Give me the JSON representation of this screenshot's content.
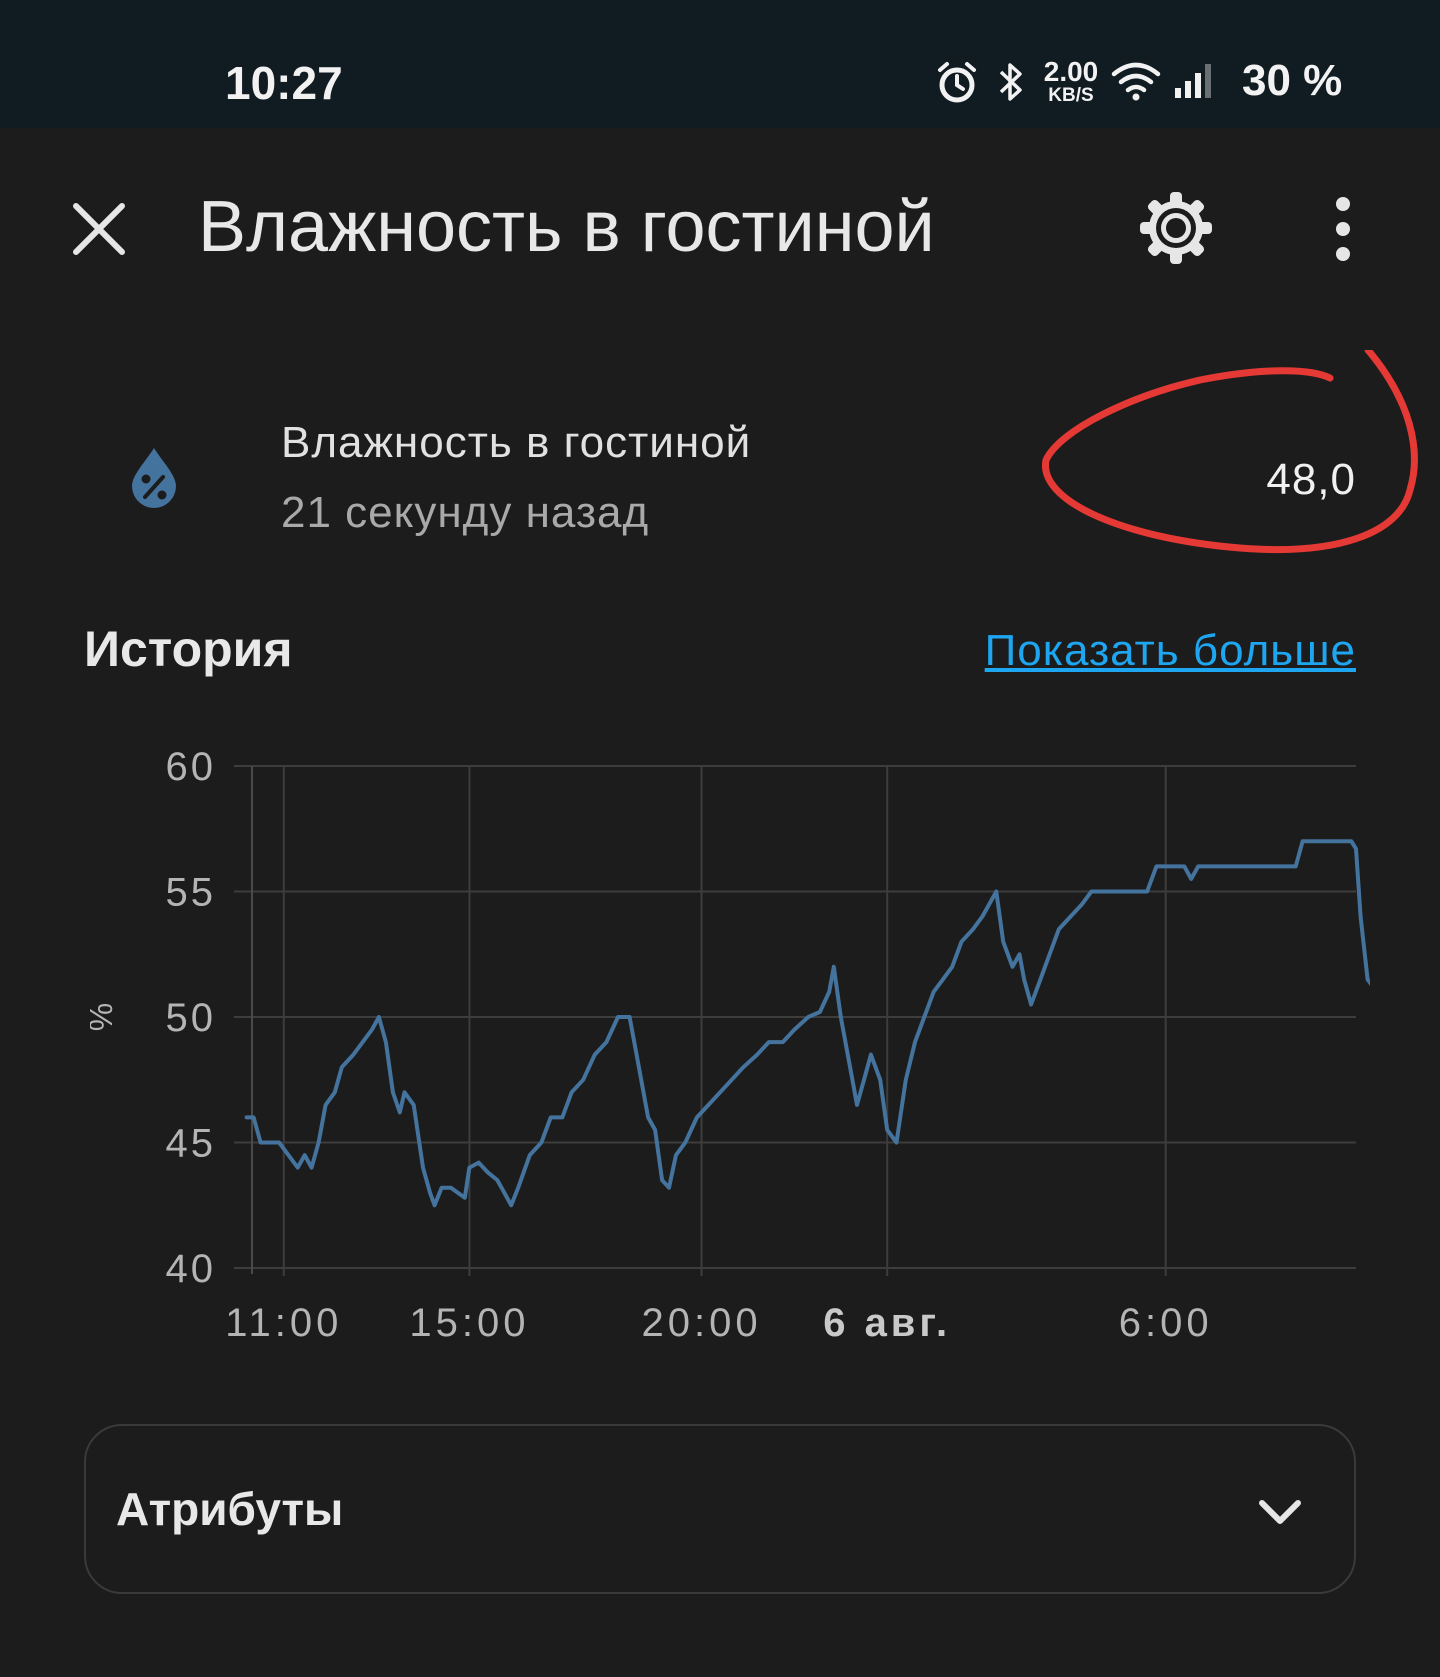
{
  "status_bar": {
    "time": "10:27",
    "net_speed_value": "2.00",
    "net_speed_unit": "KB/S",
    "battery": "30 %",
    "icons": [
      "alarm-icon",
      "bluetooth-icon",
      "wifi-icon",
      "signal-icon"
    ]
  },
  "header": {
    "title": "Влажность в гостиной",
    "icons": [
      "close-icon",
      "gear-icon",
      "more-vert-icon"
    ]
  },
  "entity": {
    "name": "Влажность в гостиной",
    "last_changed": "21 секунду назад",
    "value": "48,0",
    "icon": "water-percent-icon",
    "icon_color": "#44739e"
  },
  "history": {
    "title": "История",
    "show_more": "Показать больше"
  },
  "chart_data": {
    "type": "line",
    "ylabel": "%",
    "ylim": [
      40,
      60
    ],
    "yticks": [
      "40",
      "45",
      "50",
      "55",
      "60"
    ],
    "xlim": [
      10.1,
      34.1
    ],
    "xticks": [
      {
        "x": 11,
        "label": "11:00",
        "bold": false
      },
      {
        "x": 15,
        "label": "15:00",
        "bold": false
      },
      {
        "x": 20,
        "label": "20:00",
        "bold": false
      },
      {
        "x": 24,
        "label": "6 авг.",
        "bold": true
      },
      {
        "x": 30,
        "label": "6:00",
        "bold": false
      }
    ],
    "line_color": "#44739e",
    "grid": true,
    "series": [
      {
        "values": [
          [
            10.2,
            46
          ],
          [
            10.35,
            46
          ],
          [
            10.5,
            45
          ],
          [
            10.9,
            45
          ],
          [
            11.1,
            44.5
          ],
          [
            11.3,
            44
          ],
          [
            11.45,
            44.5
          ],
          [
            11.6,
            44
          ],
          [
            11.75,
            45
          ],
          [
            11.9,
            46.5
          ],
          [
            12.1,
            47
          ],
          [
            12.25,
            48
          ],
          [
            12.5,
            48.5
          ],
          [
            12.7,
            49
          ],
          [
            12.9,
            49.5
          ],
          [
            13.05,
            50
          ],
          [
            13.2,
            49
          ],
          [
            13.35,
            47
          ],
          [
            13.5,
            46.2
          ],
          [
            13.6,
            47
          ],
          [
            13.8,
            46.5
          ],
          [
            14.0,
            44
          ],
          [
            14.15,
            43
          ],
          [
            14.25,
            42.5
          ],
          [
            14.4,
            43.2
          ],
          [
            14.6,
            43.2
          ],
          [
            14.75,
            43
          ],
          [
            14.9,
            42.8
          ],
          [
            15.0,
            44
          ],
          [
            15.2,
            44.2
          ],
          [
            15.4,
            43.8
          ],
          [
            15.6,
            43.5
          ],
          [
            15.75,
            43
          ],
          [
            15.9,
            42.5
          ],
          [
            16.05,
            43.2
          ],
          [
            16.3,
            44.5
          ],
          [
            16.55,
            45
          ],
          [
            16.75,
            46
          ],
          [
            17.0,
            46
          ],
          [
            17.2,
            47
          ],
          [
            17.45,
            47.5
          ],
          [
            17.7,
            48.5
          ],
          [
            17.95,
            49
          ],
          [
            18.2,
            50
          ],
          [
            18.45,
            50
          ],
          [
            18.65,
            48
          ],
          [
            18.85,
            46
          ],
          [
            19.0,
            45.5
          ],
          [
            19.15,
            43.5
          ],
          [
            19.3,
            43.2
          ],
          [
            19.45,
            44.5
          ],
          [
            19.65,
            45
          ],
          [
            19.9,
            46
          ],
          [
            20.15,
            46.5
          ],
          [
            20.4,
            47
          ],
          [
            20.65,
            47.5
          ],
          [
            20.9,
            48
          ],
          [
            21.2,
            48.5
          ],
          [
            21.45,
            49
          ],
          [
            21.75,
            49
          ],
          [
            22.0,
            49.5
          ],
          [
            22.3,
            50
          ],
          [
            22.55,
            50.2
          ],
          [
            22.75,
            51
          ],
          [
            22.85,
            52
          ],
          [
            23.0,
            50
          ],
          [
            23.25,
            47.5
          ],
          [
            23.35,
            46.5
          ],
          [
            23.5,
            47.5
          ],
          [
            23.65,
            48.5
          ],
          [
            23.85,
            47.5
          ],
          [
            24.0,
            45.5
          ],
          [
            24.2,
            45
          ],
          [
            24.4,
            47.5
          ],
          [
            24.6,
            49
          ],
          [
            24.8,
            50
          ],
          [
            25.0,
            51
          ],
          [
            25.2,
            51.5
          ],
          [
            25.4,
            52
          ],
          [
            25.6,
            53
          ],
          [
            25.85,
            53.5
          ],
          [
            26.05,
            54
          ],
          [
            26.2,
            54.5
          ],
          [
            26.35,
            55
          ],
          [
            26.5,
            53
          ],
          [
            26.7,
            52
          ],
          [
            26.85,
            52.5
          ],
          [
            26.95,
            51.5
          ],
          [
            27.1,
            50.5
          ],
          [
            27.3,
            51.5
          ],
          [
            27.5,
            52.5
          ],
          [
            27.7,
            53.5
          ],
          [
            27.95,
            54
          ],
          [
            28.2,
            54.5
          ],
          [
            28.4,
            55
          ],
          [
            29.6,
            55
          ],
          [
            29.8,
            56
          ],
          [
            30.4,
            56
          ],
          [
            30.55,
            55.5
          ],
          [
            30.7,
            56
          ],
          [
            32.8,
            56
          ],
          [
            32.95,
            57
          ],
          [
            34.0,
            57
          ],
          [
            34.1,
            56.7
          ],
          [
            34.2,
            54
          ],
          [
            34.35,
            51.5
          ],
          [
            34.55,
            51
          ],
          [
            34.7,
            49.8
          ],
          [
            34.8,
            49
          ]
        ]
      }
    ]
  },
  "attributes": {
    "label": "Атрибуты"
  }
}
